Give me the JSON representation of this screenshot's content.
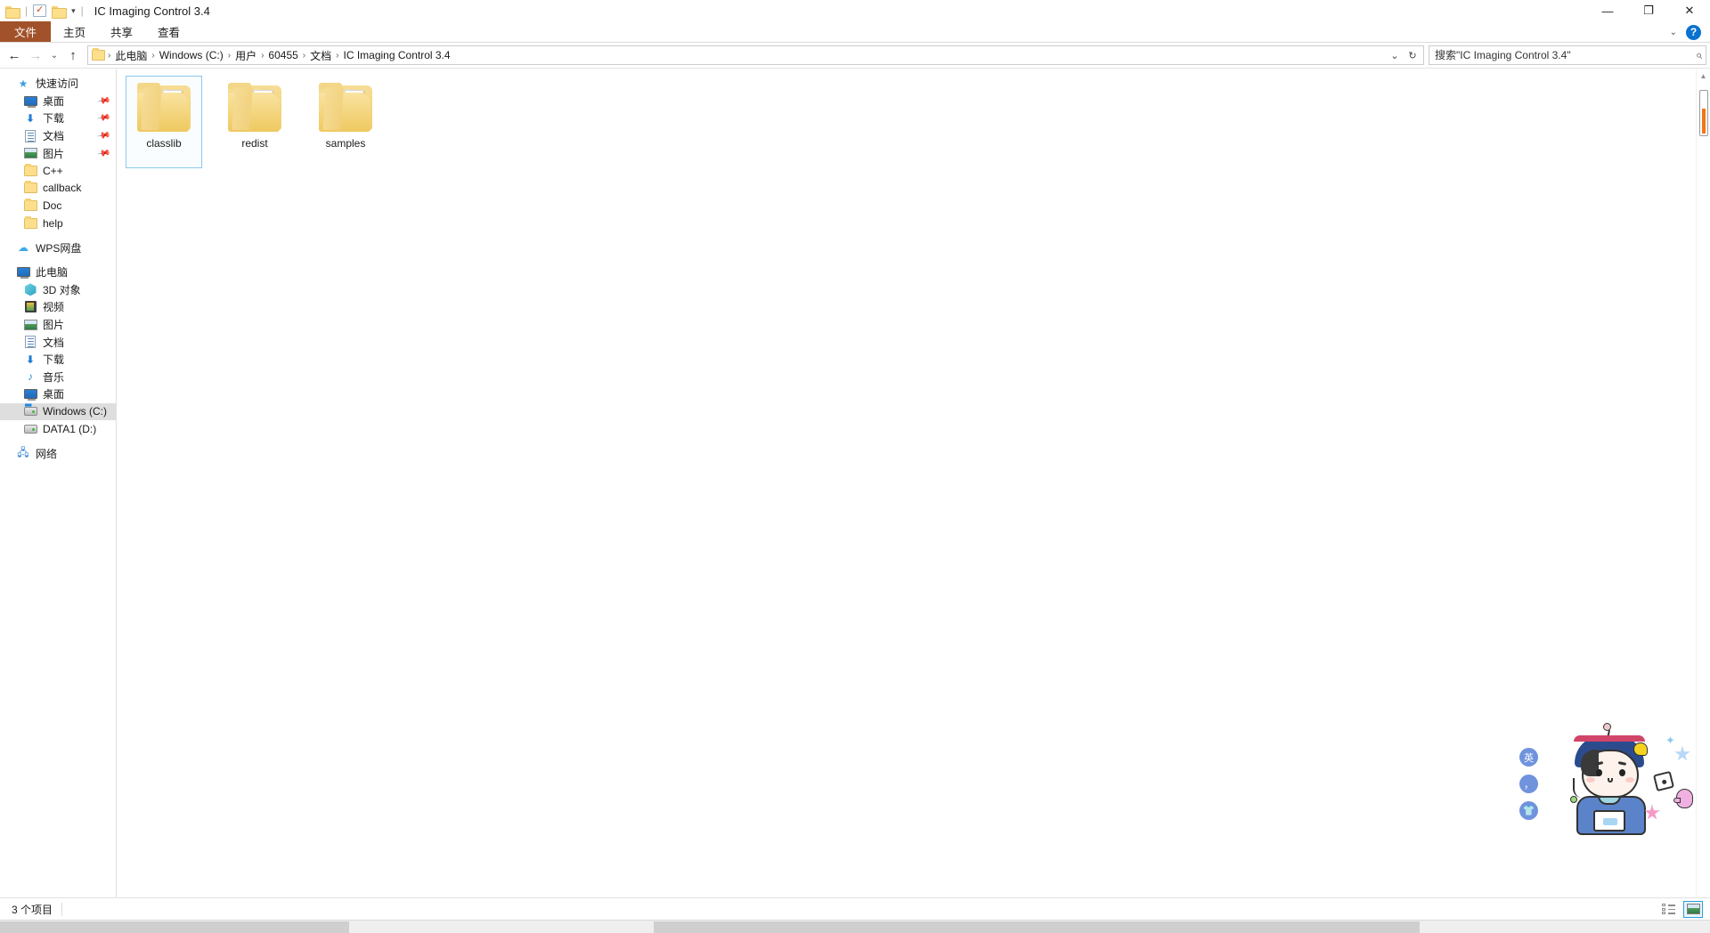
{
  "window": {
    "title": "IC Imaging Control 3.4",
    "qat": {
      "folder_icon": "folder-icon",
      "properties_icon": "properties-icon",
      "new_folder_icon": "new-folder-icon",
      "customize_caret": "▾",
      "separator": "|"
    },
    "controls": {
      "minimize": "—",
      "maximize": "❐",
      "close": "✕"
    }
  },
  "ribbon": {
    "tabs": [
      {
        "label": "文件",
        "active": true
      },
      {
        "label": "主页",
        "active": false
      },
      {
        "label": "共享",
        "active": false
      },
      {
        "label": "查看",
        "active": false
      }
    ],
    "collapse_caret": "⌄",
    "help_label": "?"
  },
  "address": {
    "back_glyph": "←",
    "forward_glyph": "→",
    "recent_glyph": "⌄",
    "up_glyph": "↑",
    "breadcrumbs": [
      "此电脑",
      "Windows (C:)",
      "用户",
      "60455",
      "文档",
      "IC Imaging Control 3.4"
    ],
    "separator": "›",
    "dropdown_glyph": "⌄",
    "refresh_glyph": "↻"
  },
  "search": {
    "placeholder": "搜索\"IC Imaging Control 3.4\"",
    "value": "",
    "icon": "search-icon"
  },
  "sidebar": {
    "groups": [
      {
        "root": {
          "label": "快速访问",
          "icon": "star-icon"
        },
        "items": [
          {
            "label": "桌面",
            "icon": "desktop-icon",
            "pinned": true
          },
          {
            "label": "下载",
            "icon": "download-icon",
            "pinned": true
          },
          {
            "label": "文档",
            "icon": "documents-icon",
            "pinned": true
          },
          {
            "label": "图片",
            "icon": "pictures-icon",
            "pinned": true
          },
          {
            "label": "C++",
            "icon": "folder-icon",
            "pinned": false
          },
          {
            "label": "callback",
            "icon": "folder-icon",
            "pinned": false
          },
          {
            "label": "Doc",
            "icon": "folder-icon",
            "pinned": false
          },
          {
            "label": "help",
            "icon": "folder-icon",
            "pinned": false
          }
        ]
      },
      {
        "root": {
          "label": "WPS网盘",
          "icon": "cloud-icon"
        },
        "items": []
      },
      {
        "root": {
          "label": "此电脑",
          "icon": "this-pc-icon"
        },
        "items": [
          {
            "label": "3D 对象",
            "icon": "3d-objects-icon",
            "pinned": false
          },
          {
            "label": "视频",
            "icon": "videos-icon",
            "pinned": false
          },
          {
            "label": "图片",
            "icon": "pictures-icon",
            "pinned": false
          },
          {
            "label": "文档",
            "icon": "documents-icon",
            "pinned": false
          },
          {
            "label": "下载",
            "icon": "download-icon",
            "pinned": false
          },
          {
            "label": "音乐",
            "icon": "music-icon",
            "pinned": false
          },
          {
            "label": "桌面",
            "icon": "desktop-icon",
            "pinned": false
          },
          {
            "label": "Windows (C:)",
            "icon": "drive-windows-icon",
            "pinned": false,
            "selected": true
          },
          {
            "label": "DATA1 (D:)",
            "icon": "drive-icon",
            "pinned": false
          }
        ]
      },
      {
        "root": {
          "label": "网络",
          "icon": "network-icon"
        },
        "items": []
      }
    ]
  },
  "content": {
    "items": [
      {
        "name": "classlib",
        "type": "folder",
        "selected": true
      },
      {
        "name": "redist",
        "type": "folder",
        "selected": false
      },
      {
        "name": "samples",
        "type": "folder",
        "selected": false
      }
    ],
    "scrollbar": {
      "up_glyph": "▲",
      "down_glyph": "▼"
    }
  },
  "ime": {
    "buttons": [
      {
        "label": "英",
        "name": "ime-language-toggle"
      },
      {
        "label": "，",
        "name": "ime-punctuation-toggle"
      },
      {
        "label": "",
        "name": "ime-skin-button"
      }
    ],
    "mascot_name": "ime-mascot"
  },
  "statusbar": {
    "item_count_text": "3 个项目",
    "views": [
      {
        "name": "details-view-button",
        "active": false
      },
      {
        "name": "large-icons-view-button",
        "active": true
      }
    ]
  },
  "colors": {
    "file_tab": "#a2522a",
    "accent_blue": "#0a72d0",
    "selection": "#8cc8ee",
    "scroll_marker": "#f07818",
    "sidebar_selected": "#dedede"
  }
}
